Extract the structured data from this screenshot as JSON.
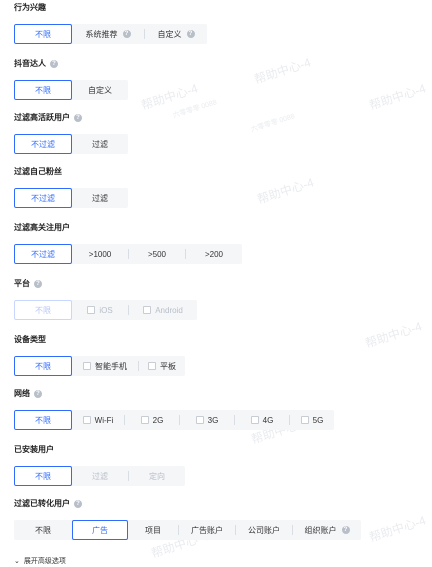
{
  "sections": {
    "behavior": {
      "title": "行为兴趣",
      "options": [
        "不限",
        "系统推荐",
        "自定义"
      ]
    },
    "douyin": {
      "title": "抖音达人",
      "options": [
        "不限",
        "自定义"
      ]
    },
    "active": {
      "title": "过滤高活跃用户",
      "options": [
        "不过滤",
        "过滤"
      ]
    },
    "fans": {
      "title": "过滤自己粉丝",
      "options": [
        "不过滤",
        "过滤"
      ]
    },
    "follow": {
      "title": "过滤高关注用户",
      "options": [
        "不过滤",
        ">1000",
        ">500",
        ">200"
      ]
    },
    "platform": {
      "title": "平台",
      "options": [
        "不限",
        "iOS",
        "Android"
      ]
    },
    "device": {
      "title": "设备类型",
      "options": [
        "不限",
        "智能手机",
        "平板"
      ]
    },
    "network": {
      "title": "网络",
      "options": [
        "不限",
        "Wi-Fi",
        "2G",
        "3G",
        "4G",
        "5G"
      ]
    },
    "installed": {
      "title": "已安装用户",
      "options": [
        "不限",
        "过滤",
        "定向"
      ]
    },
    "converted": {
      "title": "过滤已转化用户",
      "options": [
        "不限",
        "广告",
        "项目",
        "广告账户",
        "公司账户",
        "组织账户"
      ]
    }
  },
  "expand_label": "展开高级选项",
  "watermark": {
    "big": "帮助中心-4",
    "small": "六零零零 0088"
  },
  "colors": {
    "accent": "#2f6bff",
    "disabled": "#b8bec8"
  }
}
